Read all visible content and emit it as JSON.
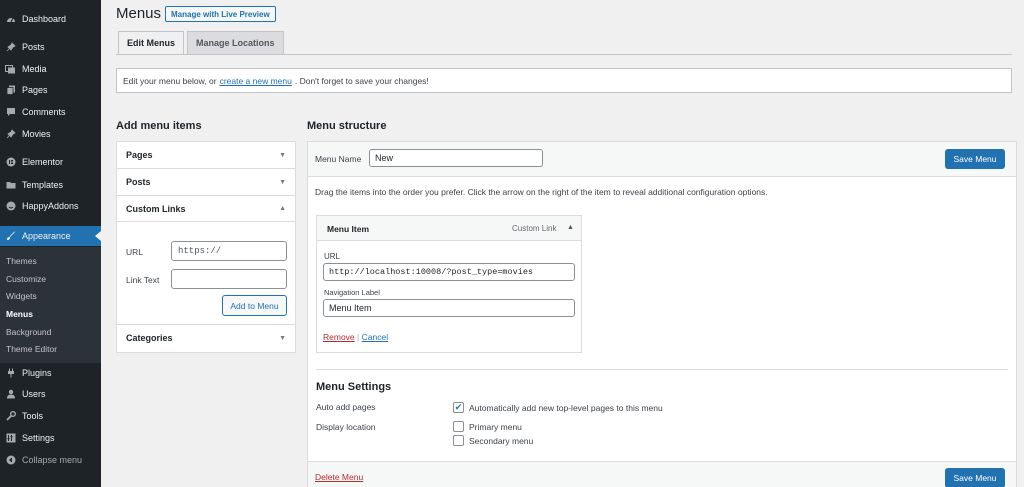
{
  "sidebar": {
    "items": [
      {
        "label": "Dashboard",
        "icon": "dashboard-icon"
      },
      {
        "label": "Posts",
        "icon": "pin-icon"
      },
      {
        "label": "Media",
        "icon": "media-icon"
      },
      {
        "label": "Pages",
        "icon": "pages-icon"
      },
      {
        "label": "Comments",
        "icon": "comment-icon"
      },
      {
        "label": "Movies",
        "icon": "pin-icon"
      },
      {
        "label": "Elementor",
        "icon": "elementor-icon"
      },
      {
        "label": "Templates",
        "icon": "folder-icon"
      },
      {
        "label": "HappyAddons",
        "icon": "happy-icon"
      },
      {
        "label": "Appearance",
        "icon": "brush-icon"
      },
      {
        "label": "Plugins",
        "icon": "plug-icon"
      },
      {
        "label": "Users",
        "icon": "users-icon"
      },
      {
        "label": "Tools",
        "icon": "wrench-icon"
      },
      {
        "label": "Settings",
        "icon": "settings-icon"
      },
      {
        "label": "Collapse menu",
        "icon": "collapse-icon"
      }
    ],
    "submenu": [
      "Themes",
      "Customize",
      "Widgets",
      "Menus",
      "Background",
      "Theme Editor"
    ]
  },
  "header": {
    "title": "Menus",
    "live_preview": "Manage with Live Preview"
  },
  "tabs": [
    "Edit Menus",
    "Manage Locations"
  ],
  "notice": {
    "before": "Edit your menu below, or",
    "link": "create a new menu",
    "after": ". Don't forget to save your changes!"
  },
  "add_items": {
    "title": "Add menu items",
    "sections": [
      "Pages",
      "Posts",
      "Custom Links",
      "Categories"
    ],
    "url_label": "URL",
    "url_placeholder": "https://",
    "link_text_label": "Link Text",
    "add_button": "Add to Menu"
  },
  "structure": {
    "title": "Menu structure",
    "menu_name_label": "Menu Name",
    "menu_name_value": "New",
    "save_button": "Save Menu",
    "instructions": "Drag the items into the order you prefer. Click the arrow on the right of the item to reveal additional configuration options.",
    "item": {
      "title": "Menu Item",
      "type": "Custom Link",
      "url_label": "URL",
      "url_value": "http://localhost:10008/?post_type=movies",
      "nav_label": "Navigation Label",
      "nav_value": "Menu Item",
      "remove": "Remove",
      "separator": "|",
      "cancel": "Cancel"
    },
    "settings": {
      "title": "Menu Settings",
      "auto_add_label": "Auto add pages",
      "auto_add_option": "Automatically add new top-level pages to this menu",
      "display_label": "Display location",
      "primary": "Primary menu",
      "secondary": "Secondary menu"
    },
    "delete": "Delete Menu"
  },
  "colors": {
    "accent": "#2271b1",
    "sidebar": "#1d2327",
    "danger": "#b32d2e"
  }
}
